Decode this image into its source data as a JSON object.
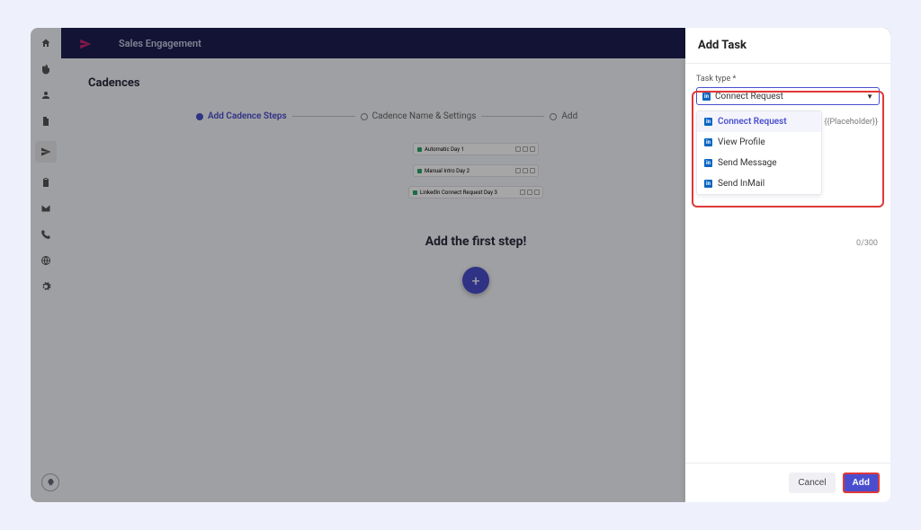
{
  "topbar": {
    "title": "Sales Engagement"
  },
  "page": {
    "title": "Cadences"
  },
  "stepper": {
    "step1": "Add Cadence Steps",
    "step2": "Cadence Name & Settings",
    "step3": "Add"
  },
  "chips": {
    "chip1": "Automatic Day 1",
    "chip2": "Manual Intro Day 2",
    "chip3": "LinkedIn Connect Request Day 3"
  },
  "firstStep": {
    "title": "Add the first step!"
  },
  "panel": {
    "title": "Add Task",
    "fieldLabel": "Task type *",
    "selected": "Connect Request",
    "placeholder": "{{Placeholder}}",
    "options": {
      "opt1": "Connect Request",
      "opt2": "View Profile",
      "opt3": "Send Message",
      "opt4": "Send InMail"
    },
    "counter": "0/300",
    "cancel": "Cancel",
    "add": "Add"
  }
}
